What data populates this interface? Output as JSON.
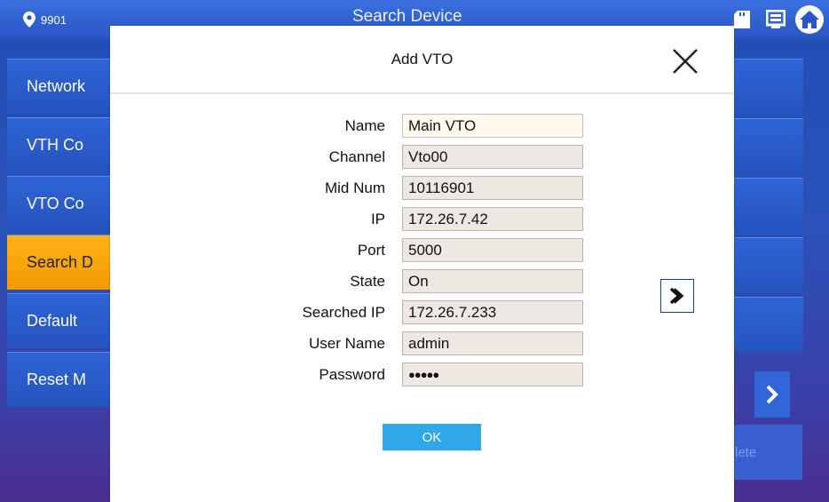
{
  "topbar": {
    "room_number": "9901",
    "title": "Search Device",
    "icons": [
      "location-pin-icon",
      "sd-card-icon",
      "monitor-icon",
      "home-icon"
    ]
  },
  "sidebar": {
    "items": [
      {
        "label": "Network"
      },
      {
        "label": "VTH Co"
      },
      {
        "label": "VTO Co"
      },
      {
        "label": "Search D",
        "active": true
      },
      {
        "label": "Default"
      },
      {
        "label": "Reset M"
      }
    ]
  },
  "right_panel": {
    "delete_label": "lete"
  },
  "dialog": {
    "title": "Add VTO",
    "fields": [
      {
        "label": "Name",
        "value": "Main VTO",
        "editable": true
      },
      {
        "label": "Channel",
        "value": "Vto00",
        "editable": false
      },
      {
        "label": "Mid Num",
        "value": "10116901",
        "editable": false
      },
      {
        "label": "IP",
        "value": "172.26.7.42",
        "editable": false
      },
      {
        "label": "Port",
        "value": "5000",
        "editable": false
      },
      {
        "label": "State",
        "value": "On",
        "editable": false
      },
      {
        "label": "Searched IP",
        "value": "172.26.7.233",
        "editable": false
      },
      {
        "label": "User Name",
        "value": "admin",
        "editable": false
      },
      {
        "label": "Password",
        "value": "●●●●●",
        "editable": false
      }
    ],
    "ok_label": "OK"
  },
  "colors": {
    "accent": "#2fa8ea",
    "active_tab": "#f39a00",
    "tile_blue": "#2553bd"
  }
}
